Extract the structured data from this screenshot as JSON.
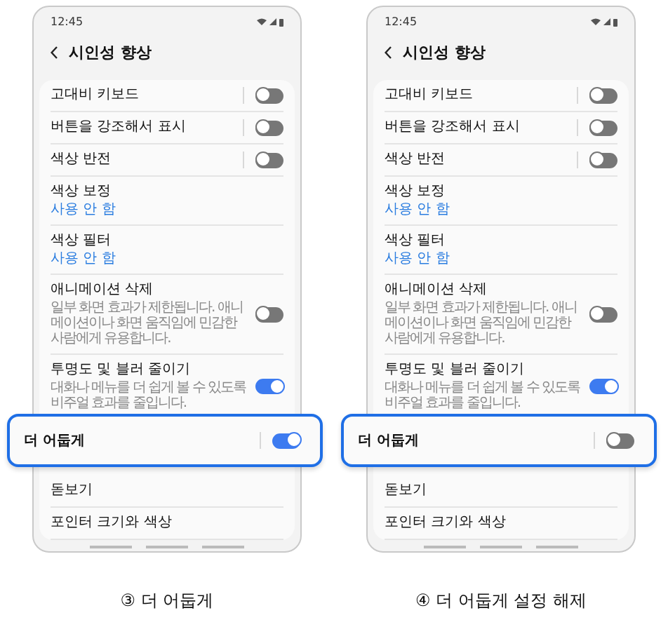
{
  "panels": [
    {
      "status_bar": {
        "time": "12:45"
      },
      "header": {
        "title": "시인성 향상"
      },
      "rows": [
        {
          "kind": "switch_split",
          "title": "고대비 키보드",
          "on": false
        },
        {
          "kind": "switch_split",
          "title": "버튼을 강조해서 표시",
          "on": false
        },
        {
          "kind": "switch_split",
          "title": "색상 반전",
          "on": false
        },
        {
          "kind": "link",
          "title": "색상 보정",
          "status": "사용 안 함"
        },
        {
          "kind": "link",
          "title": "색상 필터",
          "status": "사용 안 함"
        },
        {
          "kind": "switch",
          "title": "애니메이션 삭제",
          "description": "일부 화면 효과가 제한됩니다. 애니메이션이나 화면 움직임에 민감한 사람에게 유용합니다.",
          "on": false
        },
        {
          "kind": "switch",
          "title": "투명도 및 블러 줄이기",
          "description": "대화나 메뉴를 더 쉽게 볼 수 있도록 비주얼 효과를 줄입니다.",
          "on": true
        }
      ],
      "callout": {
        "title": "더 어둡게",
        "on": true
      },
      "after_rows": [
        {
          "title": "돋보기"
        },
        {
          "title": "포인터 크기와 색상"
        }
      ],
      "caption": "③ 더 어둡게"
    },
    {
      "status_bar": {
        "time": "12:45"
      },
      "header": {
        "title": "시인성 향상"
      },
      "rows": [
        {
          "kind": "switch_split",
          "title": "고대비 키보드",
          "on": false
        },
        {
          "kind": "switch_split",
          "title": "버튼을 강조해서 표시",
          "on": false
        },
        {
          "kind": "switch_split",
          "title": "색상 반전",
          "on": false
        },
        {
          "kind": "link",
          "title": "색상 보정",
          "status": "사용 안 함"
        },
        {
          "kind": "link",
          "title": "색상 필터",
          "status": "사용 안 함"
        },
        {
          "kind": "switch",
          "title": "애니메이션 삭제",
          "description": "일부 화면 효과가 제한됩니다. 애니메이션이나 화면 움직임에 민감한 사람에게 유용합니다.",
          "on": false
        },
        {
          "kind": "switch",
          "title": "투명도 및 블러 줄이기",
          "description": "대화나 메뉴를 더 쉽게 볼 수 있도록 비주얼 효과를 줄입니다.",
          "on": true
        }
      ],
      "callout": {
        "title": "더 어둡게",
        "on": false
      },
      "after_rows": [
        {
          "title": "돋보기"
        },
        {
          "title": "포인터 크기와 색상"
        }
      ],
      "caption": "④ 더 어둡게 설정 해제"
    }
  ]
}
